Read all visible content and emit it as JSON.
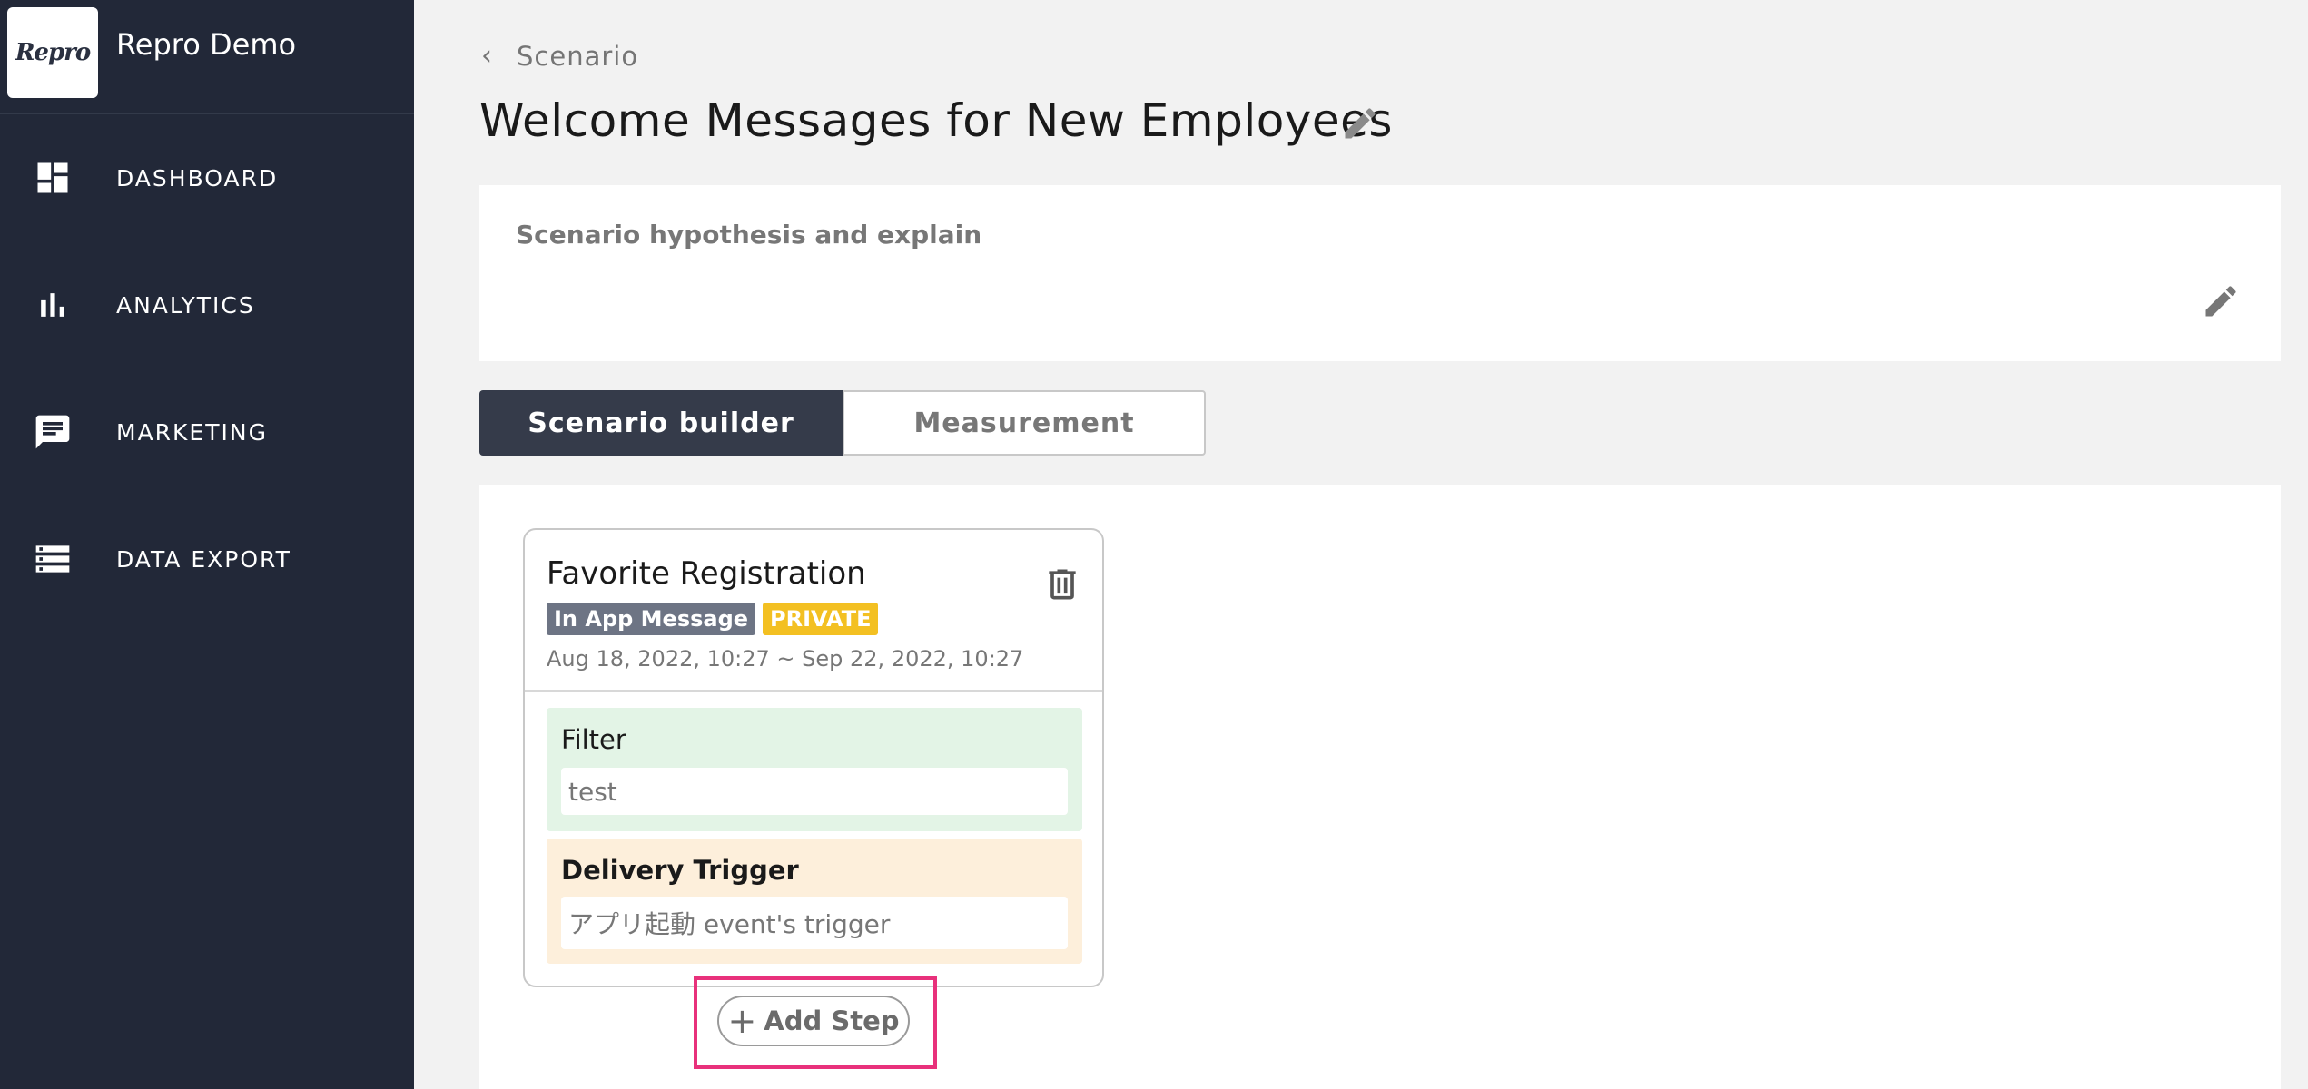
{
  "app": {
    "logo_text": "Repro",
    "name": "Repro Demo"
  },
  "sidebar": {
    "items": [
      {
        "label": "DASHBOARD",
        "icon": "dashboard-icon"
      },
      {
        "label": "ANALYTICS",
        "icon": "bar-chart-icon"
      },
      {
        "label": "MARKETING",
        "icon": "chat-icon"
      },
      {
        "label": "DATA EXPORT",
        "icon": "storage-icon"
      }
    ]
  },
  "header": {
    "back_label": "Scenario",
    "title": "Welcome Messages for New Employees"
  },
  "hypothesis": {
    "label": "Scenario hypothesis and explain"
  },
  "tabs": [
    {
      "label": "Scenario builder",
      "active": true
    },
    {
      "label": "Measurement",
      "active": false
    }
  ],
  "step": {
    "title": "Favorite Registration",
    "type_badge": "In App Message",
    "status_badge": "PRIVATE",
    "dates": "Aug 18, 2022, 10:27 ~ Sep 22, 2022, 10:27",
    "filter_label": "Filter",
    "filter_value": "test",
    "trigger_label": "Delivery Trigger",
    "trigger_value": "アプリ起動 event's trigger"
  },
  "add_step_label": "Add Step",
  "colors": {
    "sidebar_bg": "#222838",
    "tab_active_bg": "#353b4a",
    "badge_private": "#f3c022",
    "badge_type": "#6d7484",
    "filter_bg": "#e3f4e6",
    "trigger_bg": "#fdefdb",
    "highlight": "#e8317b"
  }
}
